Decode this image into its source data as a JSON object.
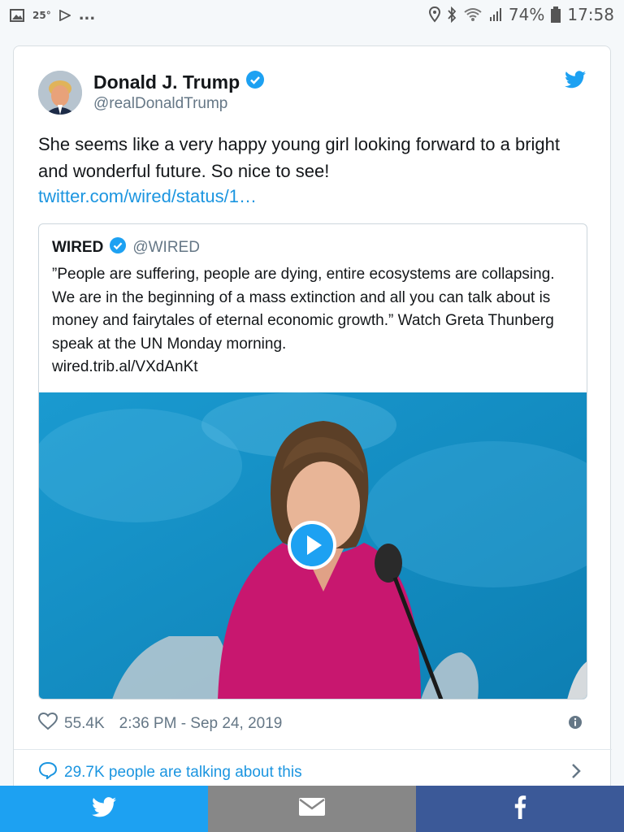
{
  "status_bar": {
    "temperature": "25°",
    "more": "...",
    "battery": "74%",
    "time": "17:58"
  },
  "tweet": {
    "author_name": "Donald J. Trump",
    "author_handle": "@realDonaldTrump",
    "text": "She seems like a very happy young girl looking forward to a bright and wonderful future. So nice to see!",
    "link": "twitter.com/wired/status/1…",
    "likes": "55.4K",
    "timestamp": "2:36 PM - Sep 24, 2019",
    "talking": "29.7K people are talking about this"
  },
  "quote": {
    "author_name": "WIRED",
    "author_handle": "@WIRED",
    "text": "”People are suffering, people are dying, entire ecosystems are collapsing. We are in the beginning of a mass extinction and all you can talk about is money and fairytales of eternal economic growth.” Watch Greta Thunberg speak at the UN Monday morning.",
    "link": "wired.trib.al/VXdAnKt"
  },
  "colors": {
    "twitter_blue": "#1da1f2",
    "link_blue": "#1b95e0",
    "mail_gray": "#878787",
    "facebook_blue": "#3b5998",
    "verified_blue": "#1da1f2"
  },
  "share_bar": {
    "buttons": [
      "twitter-icon",
      "mail-icon",
      "facebook-icon"
    ]
  }
}
